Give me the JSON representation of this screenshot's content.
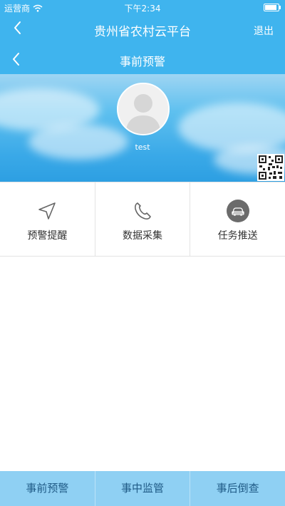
{
  "status_bar": {
    "carrier": "运营商",
    "time": "下午2:34",
    "battery_level": 0.9
  },
  "header": {
    "title": "贵州省农村云平台",
    "logout_label": "退出"
  },
  "subheader": {
    "title": "事前预警"
  },
  "profile": {
    "username": "test"
  },
  "grid": {
    "items": [
      {
        "label": "预警提醒",
        "icon": "navigation-arrow-icon"
      },
      {
        "label": "数据采集",
        "icon": "phone-icon"
      },
      {
        "label": "任务推送",
        "icon": "car-icon"
      }
    ]
  },
  "tabbar": {
    "items": [
      {
        "label": "事前预警"
      },
      {
        "label": "事中监管"
      },
      {
        "label": "事后倒查"
      }
    ]
  },
  "colors": {
    "primary": "#3fb4ee",
    "tabbar": "#8fd0f3",
    "tab_text": "#1f5a86"
  }
}
